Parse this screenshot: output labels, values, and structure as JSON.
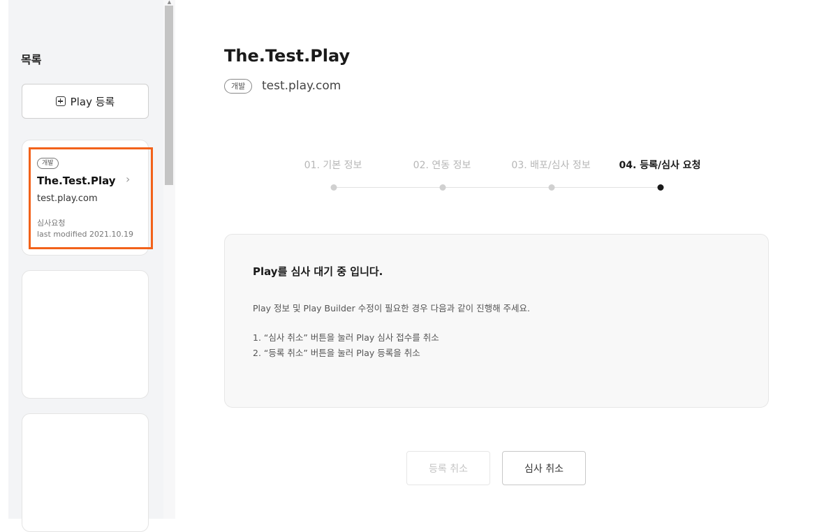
{
  "sidebar": {
    "title": "목록",
    "add_button_label": "Play 등록",
    "cards": [
      {
        "badge": "개발",
        "name": "The.Test.Play",
        "url": "test.play.com",
        "status": "심사요청",
        "last_modified": "last modified 2021.10.19"
      }
    ]
  },
  "main": {
    "title": "The.Test.Play",
    "badge": "개발",
    "url": "test.play.com"
  },
  "steps": {
    "items": [
      {
        "label": "01. 기본 정보",
        "active": false
      },
      {
        "label": "02. 연동 정보",
        "active": false
      },
      {
        "label": "03. 배포/심사 정보",
        "active": false
      },
      {
        "label": "04. 등록/심사 요청",
        "active": true
      }
    ]
  },
  "notice": {
    "heading": "Play를 심사 대기 중 입니다.",
    "description": "Play 정보 및 Play Builder 수정이 필요한 경우 다음과 같이 진행해 주세요.",
    "line1": "1. “심사 취소” 버튼을 눌러 Play 심사 접수를 취소",
    "line2": "2. “등록 취소” 버튼을 눌러 Play 등록을 취소"
  },
  "actions": {
    "cancel_registration": "등록 취소",
    "cancel_review": "심사 취소"
  },
  "colors": {
    "highlight": "#f2621a",
    "active_step": "#1a1a1a",
    "inactive_step": "#b6b6b6"
  }
}
